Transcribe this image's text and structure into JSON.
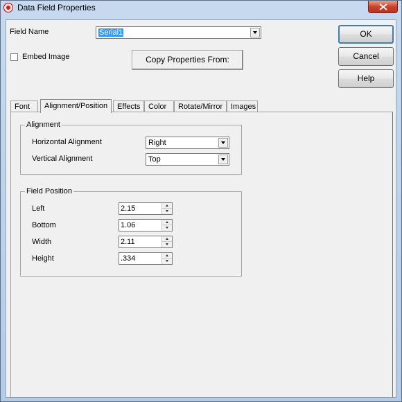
{
  "window": {
    "title": "Data Field Properties",
    "app_icon": "app-logo-icon",
    "close_icon": "close-icon"
  },
  "field_name": {
    "label": "Field Name",
    "value": "Serial1"
  },
  "embed_image": {
    "label": "Embed Image",
    "checked": false
  },
  "copy_button": {
    "label": "Copy Properties From:"
  },
  "buttons": {
    "ok": "OK",
    "cancel": "Cancel",
    "help": "Help"
  },
  "tabs": [
    {
      "label": "Font"
    },
    {
      "label": "Alignment/Position",
      "active": true
    },
    {
      "label": "Effects"
    },
    {
      "label": "Color"
    },
    {
      "label": "Rotate/Mirror"
    },
    {
      "label": "Images"
    }
  ],
  "alignment": {
    "title": "Alignment",
    "horizontal": {
      "label": "Horizontal Alignment",
      "value": "Right"
    },
    "vertical": {
      "label": "Vertical Alignment",
      "value": "Top"
    }
  },
  "position": {
    "title": "Field Position",
    "left": {
      "label": "Left",
      "value": "2.15"
    },
    "bottom": {
      "label": "Bottom",
      "value": "1.06"
    },
    "width": {
      "label": "Width",
      "value": "2.11"
    },
    "height": {
      "label": "Height",
      "value": ".334"
    }
  }
}
